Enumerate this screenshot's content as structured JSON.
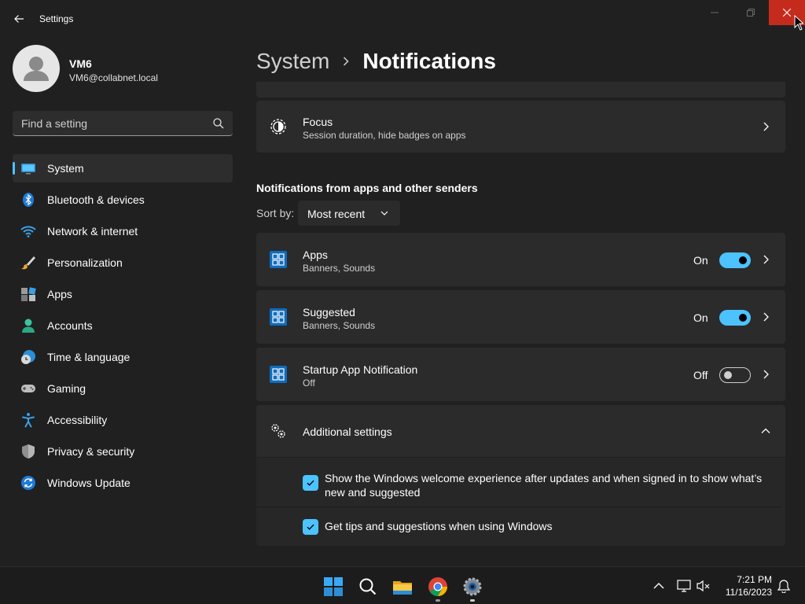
{
  "window": {
    "app_title": "Settings"
  },
  "user": {
    "name": "VM6",
    "email": "VM6@collabnet.local"
  },
  "search": {
    "placeholder": "Find a setting"
  },
  "sidebar": {
    "items": [
      {
        "label": "System",
        "icon": "system-icon",
        "selected": true
      },
      {
        "label": "Bluetooth & devices",
        "icon": "bluetooth-icon"
      },
      {
        "label": "Network & internet",
        "icon": "wifi-icon"
      },
      {
        "label": "Personalization",
        "icon": "brush-icon"
      },
      {
        "label": "Apps",
        "icon": "apps-icon"
      },
      {
        "label": "Accounts",
        "icon": "person-icon"
      },
      {
        "label": "Time & language",
        "icon": "globe-clock-icon"
      },
      {
        "label": "Gaming",
        "icon": "gamepad-icon"
      },
      {
        "label": "Accessibility",
        "icon": "accessibility-icon"
      },
      {
        "label": "Privacy & security",
        "icon": "shield-icon"
      },
      {
        "label": "Windows Update",
        "icon": "update-icon"
      }
    ]
  },
  "breadcrumb": {
    "parent": "System",
    "current": "Notifications"
  },
  "focus": {
    "title": "Focus",
    "subtitle": "Session duration, hide badges on apps"
  },
  "senders": {
    "section_title": "Notifications from apps and other senders",
    "sort_label": "Sort by:",
    "sort_value": "Most recent",
    "rows": [
      {
        "title": "Apps",
        "subtitle": "Banners, Sounds",
        "state_label": "On",
        "on": true
      },
      {
        "title": "Suggested",
        "subtitle": "Banners, Sounds",
        "state_label": "On",
        "on": true
      },
      {
        "title": "Startup App Notification",
        "subtitle": "Off",
        "state_label": "Off",
        "on": false
      }
    ]
  },
  "additional": {
    "title": "Additional settings",
    "options": [
      {
        "text": "Show the Windows welcome experience after updates and when signed in to show what’s new and suggested",
        "checked": true
      },
      {
        "text": "Get tips and suggestions when using Windows",
        "checked": true
      }
    ]
  },
  "taskbar": {
    "time": "7:21 PM",
    "date": "11/16/2023",
    "apps": [
      "start-icon",
      "search-icon",
      "file-explorer-icon",
      "chrome-icon",
      "settings-icon"
    ]
  },
  "colors": {
    "accent": "#4cc2ff",
    "close": "#c42b1c",
    "background": "#202020",
    "card": "#2b2b2b"
  }
}
